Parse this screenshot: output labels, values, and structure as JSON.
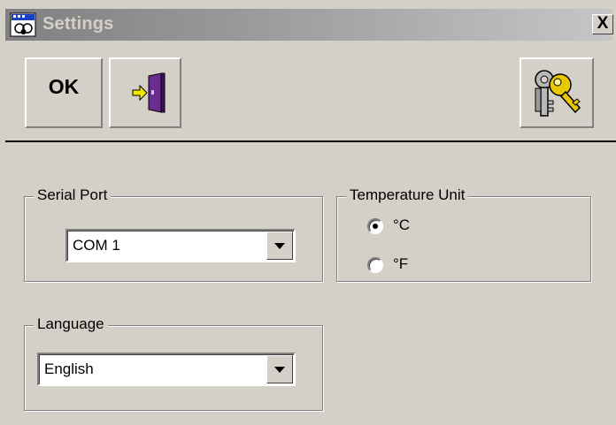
{
  "window": {
    "title": "Settings",
    "close_label": "X"
  },
  "toolbar": {
    "ok_label": "OK",
    "exit_icon": "door-exit-icon",
    "key_icon": "keys-icon"
  },
  "serial_port": {
    "label": "Serial Port",
    "selected": "COM 1"
  },
  "temperature_unit": {
    "label": "Temperature Unit",
    "options": [
      {
        "label": "°C",
        "checked": true
      },
      {
        "label": "°F",
        "checked": false
      }
    ]
  },
  "language": {
    "label": "Language",
    "selected": "English"
  },
  "colors": {
    "face": "#d4d0c8",
    "title_gradient_start": "#808080",
    "title_gradient_end": "#c6c6c6",
    "door": "#6a2c8e",
    "arrow": "#f0e800",
    "key": "#e8c800"
  }
}
